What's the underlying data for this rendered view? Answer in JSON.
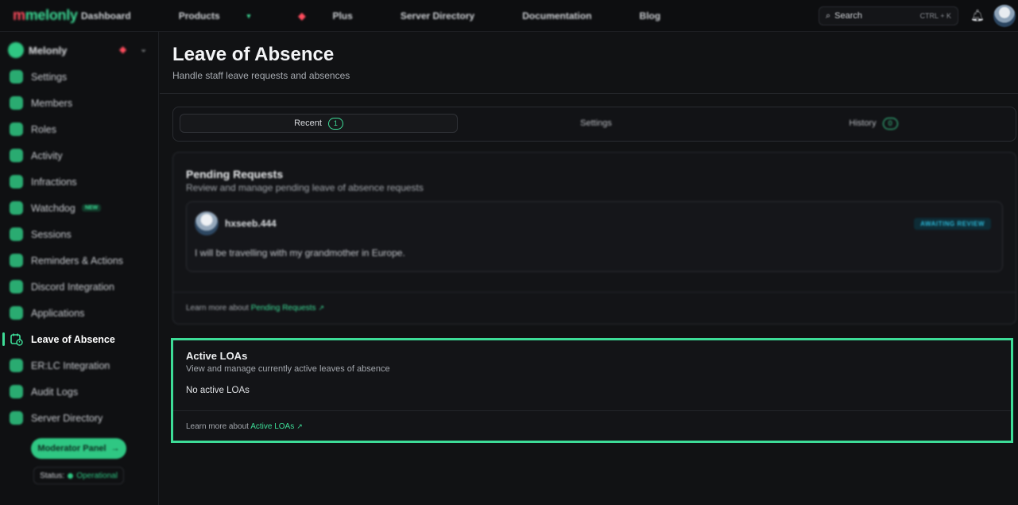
{
  "topbar": {
    "logo": "melonly",
    "nav": [
      "Dashboard",
      "Products",
      "Plus",
      "Server Directory",
      "Documentation",
      "Blog"
    ],
    "search_label": "Search",
    "search_shortcut": "CTRL + K"
  },
  "sidebar": {
    "server_name": "Melonly",
    "items": [
      {
        "label": "Settings"
      },
      {
        "label": "Members"
      },
      {
        "label": "Roles"
      },
      {
        "label": "Activity"
      },
      {
        "label": "Infractions"
      },
      {
        "label": "Watchdog",
        "badge": "NEW"
      },
      {
        "label": "Sessions"
      },
      {
        "label": "Reminders & Actions"
      },
      {
        "label": "Discord Integration"
      },
      {
        "label": "Applications"
      },
      {
        "label": "Leave of Absence"
      },
      {
        "label": "ER:LC Integration"
      },
      {
        "label": "Audit Logs"
      },
      {
        "label": "Server Directory"
      }
    ],
    "moderator_button": "Moderator Panel",
    "status_label": "Status:",
    "status_value": "Operational"
  },
  "page": {
    "title": "Leave of Absence",
    "subtitle": "Handle staff leave requests and absences"
  },
  "tabs": [
    {
      "label": "Recent",
      "count": "1"
    },
    {
      "label": "Settings"
    },
    {
      "label": "History",
      "count": "0"
    }
  ],
  "pending": {
    "title": "Pending Requests",
    "subtitle": "Review and manage pending leave of absence requests",
    "request": {
      "user": "hxseeb.444",
      "status": "AWAITING REVIEW",
      "reason": "I will be travelling with my grandmother in Europe."
    },
    "learn_prefix": "Learn more about",
    "learn_link": "Pending Requests"
  },
  "active": {
    "title": "Active LOAs",
    "subtitle": "View and manage currently active leaves of absence",
    "empty": "No active LOAs",
    "learn_prefix": "Learn more about",
    "learn_link": "Active LOAs"
  },
  "colors": {
    "accent": "#3ddc97",
    "background": "#111214",
    "status_awaiting": "#2bb7d6"
  }
}
